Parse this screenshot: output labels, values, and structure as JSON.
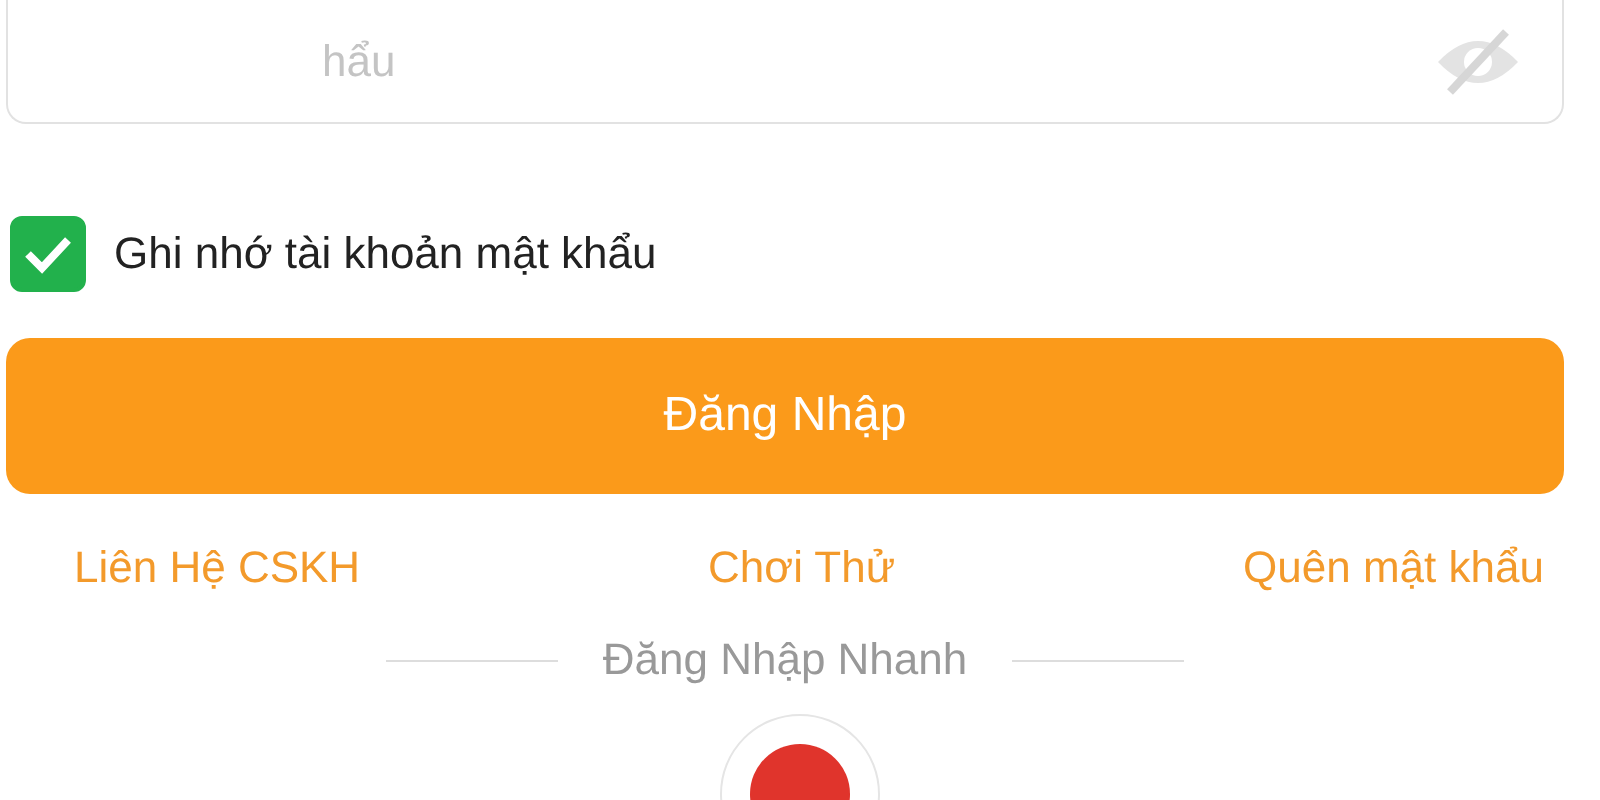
{
  "password_field": {
    "placeholder": "hẩu",
    "show_password": false
  },
  "remember": {
    "label": "Ghi nhớ tài khoản mật khẩu",
    "checked": true
  },
  "login_button": "Đăng Nhập",
  "links": [
    "Liên Hệ CSKH",
    "Chơi Thử",
    "Quên mật khẩu"
  ],
  "quick_login": {
    "title": "Đăng Nhập Nhanh"
  }
}
